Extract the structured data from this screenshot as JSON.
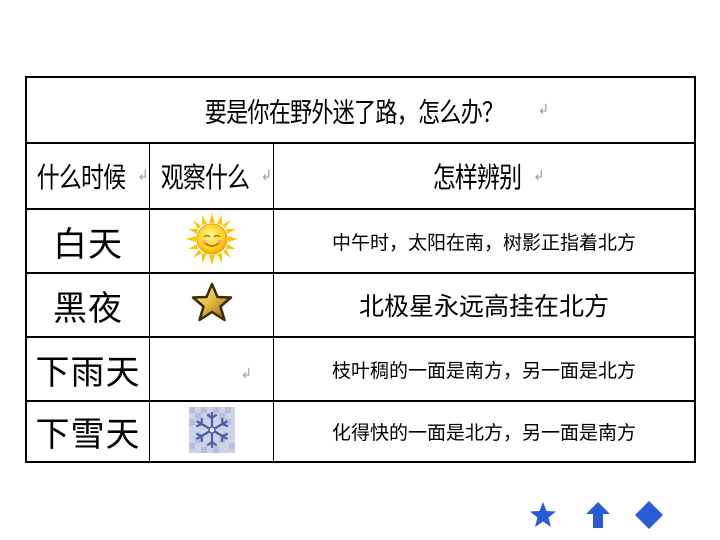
{
  "table": {
    "title": "要是你在野外迷了路，怎么办？",
    "headers": [
      "什么时候",
      "观察什么",
      "怎样辨别"
    ],
    "rows": [
      {
        "when": "白天",
        "icon": "sun-icon",
        "how": "中午时，太阳在南，树影正指着北方"
      },
      {
        "when": "黑夜",
        "icon": "star-icon",
        "how": "北极星永远高挂在北方"
      },
      {
        "when": "下雨天",
        "icon": "",
        "how": "枝叶稠的一面是南方，另一面是北方"
      },
      {
        "when": "下雪天",
        "icon": "snowflake-icon",
        "how": "化得快的一面是北方，另一面是南方"
      }
    ]
  },
  "return_mark": "↲",
  "nav": {
    "star": "nav-star-icon",
    "up": "nav-up-arrow-icon",
    "diamond": "nav-diamond-icon",
    "color": "#2a5bd7"
  }
}
